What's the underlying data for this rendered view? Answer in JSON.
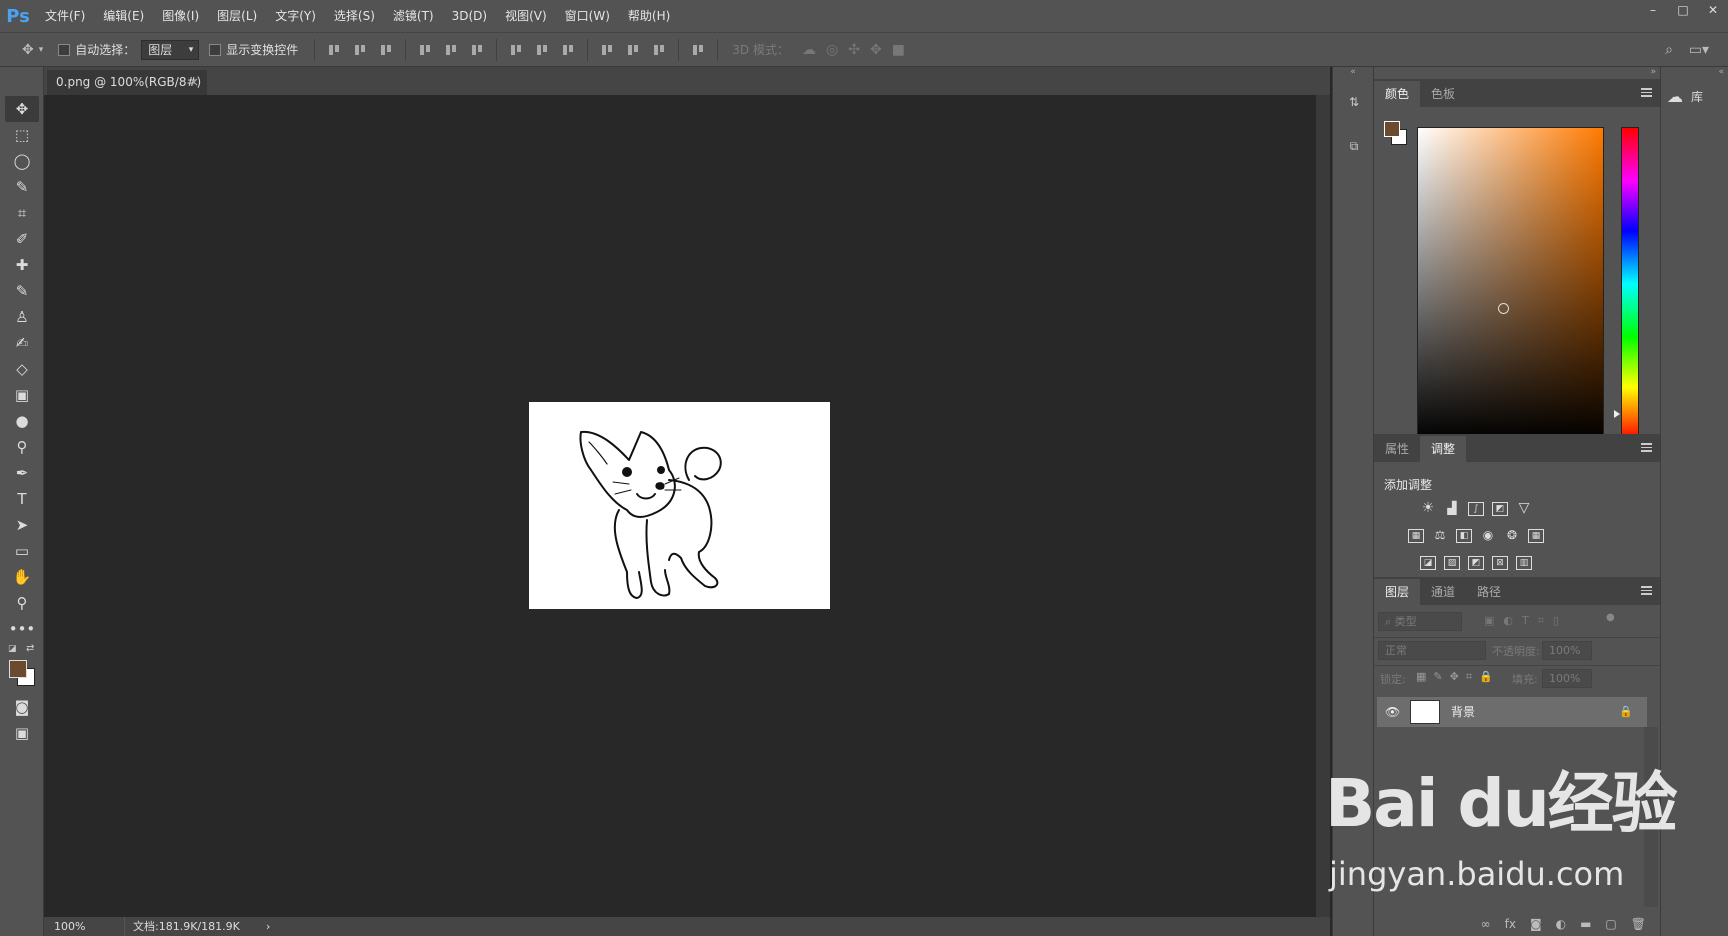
{
  "app": {
    "logo": "Ps"
  },
  "menu": [
    "文件(F)",
    "编辑(E)",
    "图像(I)",
    "图层(L)",
    "文字(Y)",
    "选择(S)",
    "滤镜(T)",
    "3D(D)",
    "视图(V)",
    "窗口(W)",
    "帮助(H)"
  ],
  "window_controls": {
    "minimize": "–",
    "maximize": "□",
    "close": "✕"
  },
  "options": {
    "auto_select_label": "自动选择：",
    "auto_select_value": "图层",
    "show_transform_label": "显示变换控件",
    "mode_3d_label": "3D 模式："
  },
  "document": {
    "tab_title": "0.png @ 100%(RGB/8#)",
    "tab_close": "×"
  },
  "status": {
    "zoom": "100%",
    "doc_size": "文档:181.9K/181.9K",
    "arrow": "›"
  },
  "color_panel": {
    "tabs": [
      "颜色",
      "色板"
    ],
    "foreground": "#6b4a2e",
    "background": "#ffffff"
  },
  "adjust_panel": {
    "tabs": [
      "属性",
      "调整"
    ],
    "title": "添加调整"
  },
  "layers_panel": {
    "tabs": [
      "图层",
      "通道",
      "路径"
    ],
    "filter_placeholder": "类型",
    "blend_mode": "正常",
    "opacity_label": "不透明度:",
    "opacity_value": "100%",
    "lock_label": "锁定:",
    "fill_label": "填充:",
    "fill_value": "100%",
    "layers": [
      {
        "name": "背景",
        "visible": true,
        "locked": true
      }
    ]
  },
  "right_col": {
    "library_label": "库"
  },
  "watermark": {
    "big": "Bai du经验",
    "small": "jingyan.baidu.com"
  }
}
